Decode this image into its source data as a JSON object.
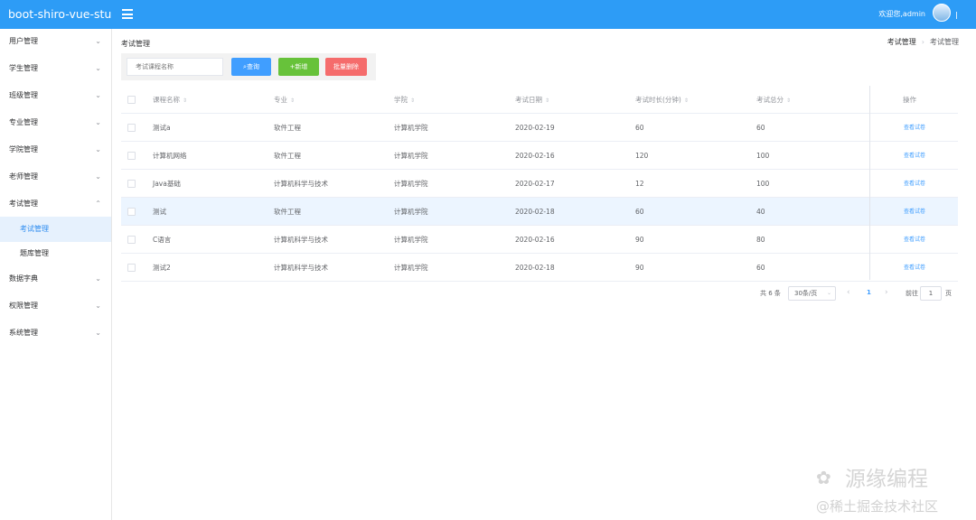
{
  "header": {
    "brand": "boot-shiro-vue-stu",
    "welcome": "欢迎您,admin",
    "accent_color": "#2d9cf6"
  },
  "sidebar": {
    "items": [
      {
        "label": "用户管理",
        "chevron": "⌄"
      },
      {
        "label": "学生管理",
        "chevron": "⌄"
      },
      {
        "label": "班级管理",
        "chevron": "⌄"
      },
      {
        "label": "专业管理",
        "chevron": "⌄"
      },
      {
        "label": "学院管理",
        "chevron": "⌄"
      },
      {
        "label": "老师管理",
        "chevron": "⌄"
      },
      {
        "label": "考试管理",
        "chevron": "⌃"
      },
      {
        "label": "考试管理"
      },
      {
        "label": "题库管理"
      },
      {
        "label": "数据字典",
        "chevron": "⌄"
      },
      {
        "label": "权限管理",
        "chevron": "⌄"
      },
      {
        "label": "系统管理",
        "chevron": "⌄"
      }
    ]
  },
  "main": {
    "title": "考试管理",
    "breadcrumb": {
      "parent": "考试管理",
      "current": "考试管理",
      "separator": "›"
    }
  },
  "toolbar": {
    "search_placeholder": "考试课程名称",
    "query_label": "查询",
    "query_icon": "search-icon",
    "add_label": "+新增",
    "delete_label": "批量删除"
  },
  "table": {
    "columns": [
      "课程名称",
      "专业",
      "学院",
      "考试日期",
      "考试时长(分钟)",
      "考试总分",
      "操作"
    ],
    "rows": [
      {
        "name": "测试a",
        "major": "软件工程",
        "college": "计算机学院",
        "date": "2020-02-19",
        "duration": "60",
        "score": "60",
        "action": "查看试卷"
      },
      {
        "name": "计算机网络",
        "major": "软件工程",
        "college": "计算机学院",
        "date": "2020-02-16",
        "duration": "120",
        "score": "100",
        "action": "查看试卷"
      },
      {
        "name": "Java基础",
        "major": "计算机科学与技术",
        "college": "计算机学院",
        "date": "2020-02-17",
        "duration": "12",
        "score": "100",
        "action": "查看试卷"
      },
      {
        "name": "测试",
        "major": "软件工程",
        "college": "计算机学院",
        "date": "2020-02-18",
        "duration": "60",
        "score": "40",
        "action": "查看试卷"
      },
      {
        "name": "C语言",
        "major": "计算机科学与技术",
        "college": "计算机学院",
        "date": "2020-02-16",
        "duration": "90",
        "score": "80",
        "action": "查看试卷"
      },
      {
        "name": "测试2",
        "major": "计算机科学与技术",
        "college": "计算机学院",
        "date": "2020-02-18",
        "duration": "90",
        "score": "60",
        "action": "查看试卷"
      }
    ]
  },
  "pagination": {
    "total": "共 6 条",
    "page_size": "30条/页",
    "current_page": "1",
    "goto_label": "前往",
    "goto_value": "1",
    "goto_unit": "页"
  },
  "watermark": {
    "line1": "源缘编程",
    "line2": "@稀土掘金技术社区"
  }
}
